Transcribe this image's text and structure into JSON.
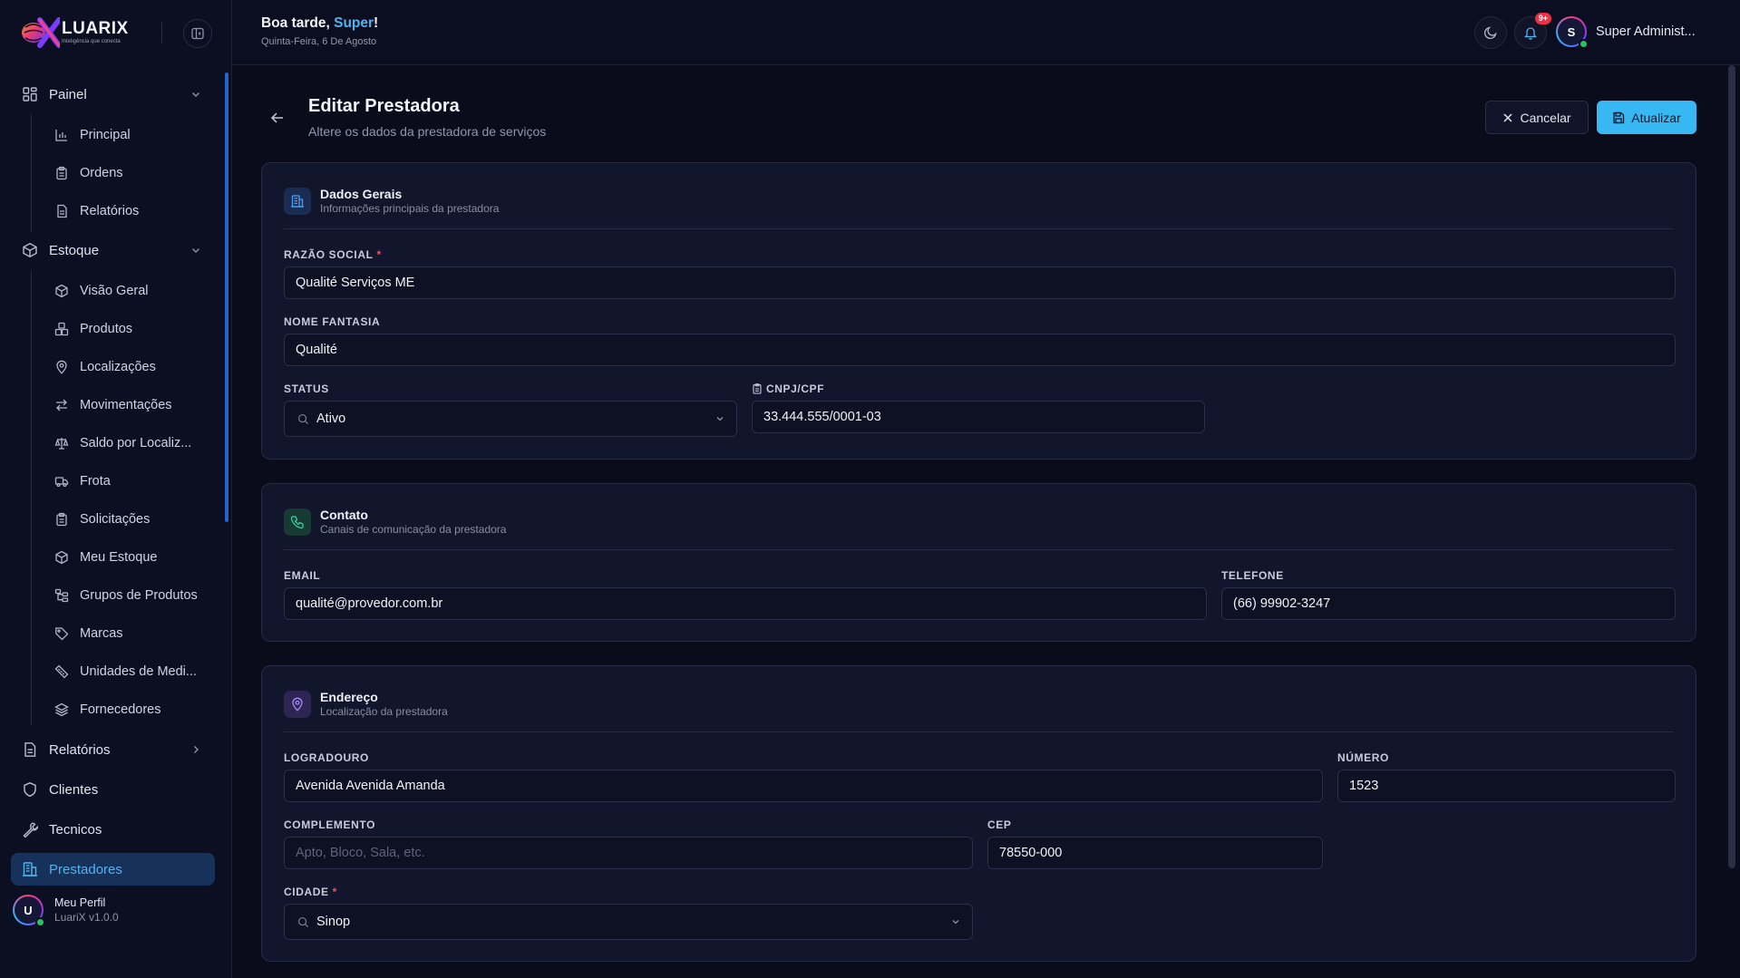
{
  "brand": {
    "name": "LUARIX",
    "tagline": "Inteligência que conecta"
  },
  "header": {
    "greeting_prefix": "Boa tarde, ",
    "greeting_name": "Super",
    "greeting_suffix": "!",
    "date": "Quinta-Feira, 6 De Agosto",
    "notifications_badge": "9+",
    "user_initial": "S",
    "user_name": "Super Administ..."
  },
  "sidebar": {
    "painel": {
      "label": "Painel",
      "items": [
        "Principal",
        "Ordens",
        "Relatórios"
      ]
    },
    "estoque": {
      "label": "Estoque",
      "items": [
        "Visão Geral",
        "Produtos",
        "Localizações",
        "Movimentações",
        "Saldo por Localiz...",
        "Frota",
        "Solicitações",
        "Meu Estoque",
        "Grupos de Produtos",
        "Marcas",
        "Unidades de Medi...",
        "Fornecedores"
      ]
    },
    "relatorios": "Relatórios",
    "clientes": "Clientes",
    "tecnicos": "Tecnicos",
    "prestadores": "Prestadores",
    "profile": {
      "initial": "U",
      "name": "Meu Perfil",
      "version": "LuariX v1.0.0"
    }
  },
  "page": {
    "title": "Editar Prestadora",
    "subtitle": "Altere os dados da prestadora de serviços",
    "cancel_label": "Cancelar",
    "update_label": "Atualizar"
  },
  "dados_gerais": {
    "title": "Dados Gerais",
    "description": "Informações principais da prestadora",
    "razao_social_label": "RAZÃO SOCIAL",
    "razao_social_value": "Qualité Serviços ME",
    "nome_fantasia_label": "NOME FANTASIA",
    "nome_fantasia_value": "Qualité",
    "status_label": "STATUS",
    "status_value": "Ativo",
    "cnpj_label": "CNPJ/CPF",
    "cnpj_value": "33.444.555/0001-03"
  },
  "contato": {
    "title": "Contato",
    "description": "Canais de comunicação da prestadora",
    "email_label": "EMAIL",
    "email_value": "qualité@provedor.com.br",
    "telefone_label": "TELEFONE",
    "telefone_value": "(66) 99902-3247"
  },
  "endereco": {
    "title": "Endereço",
    "description": "Localização da prestadora",
    "logradouro_label": "LOGRADOURO",
    "logradouro_value": "Avenida Avenida Amanda",
    "numero_label": "NÚMERO",
    "numero_value": "1523",
    "complemento_label": "COMPLEMENTO",
    "complemento_placeholder": "Apto, Bloco, Sala, etc.",
    "cep_label": "CEP",
    "cep_value": "78550-000",
    "cidade_label": "CIDADE",
    "cidade_value": "Sinop"
  },
  "colors": {
    "accent": "#38b8f2",
    "required": "#f0505e",
    "online": "#22c55e"
  }
}
